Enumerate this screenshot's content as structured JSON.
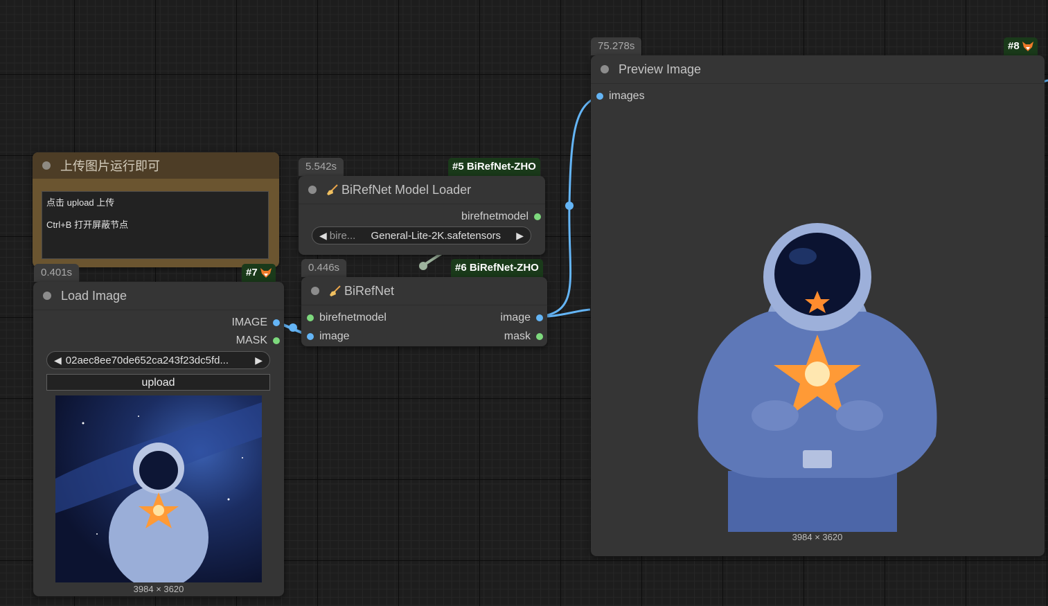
{
  "note_node": {
    "title": "上传图片运行即可",
    "lines": [
      "点击 upload 上传",
      "Ctrl+B 打开屏蔽节点"
    ]
  },
  "load_image": {
    "time": "0.401s",
    "id": "#7",
    "title": "Load Image",
    "outputs": [
      "IMAGE",
      "MASK"
    ],
    "file_value": "02aec8ee70de652ca243f23dc5fd...",
    "upload_label": "upload",
    "dimensions": "3984 × 3620"
  },
  "model_loader": {
    "time": "5.542s",
    "id": "#5 BiRefNet-ZHO",
    "title": "BiRefNet Model Loader",
    "output": "birefnetmodel",
    "combo_label": "bire...",
    "combo_value": "General-Lite-2K.safetensors"
  },
  "birefnet": {
    "time": "0.446s",
    "id": "#6 BiRefNet-ZHO",
    "title": "BiRefNet",
    "inputs": [
      "birefnetmodel",
      "image"
    ],
    "outputs": [
      "image",
      "mask"
    ]
  },
  "preview": {
    "time": "75.278s",
    "id": "#8",
    "title": "Preview Image",
    "input": "images",
    "dimensions": "3984 × 3620"
  },
  "colors": {
    "image_link": "#64b5f6",
    "model_link": "#9db39d",
    "mask_slot": "#7dd97d",
    "id_badge_bg": "#1a3a1a",
    "note_bg": "#6b5530"
  }
}
